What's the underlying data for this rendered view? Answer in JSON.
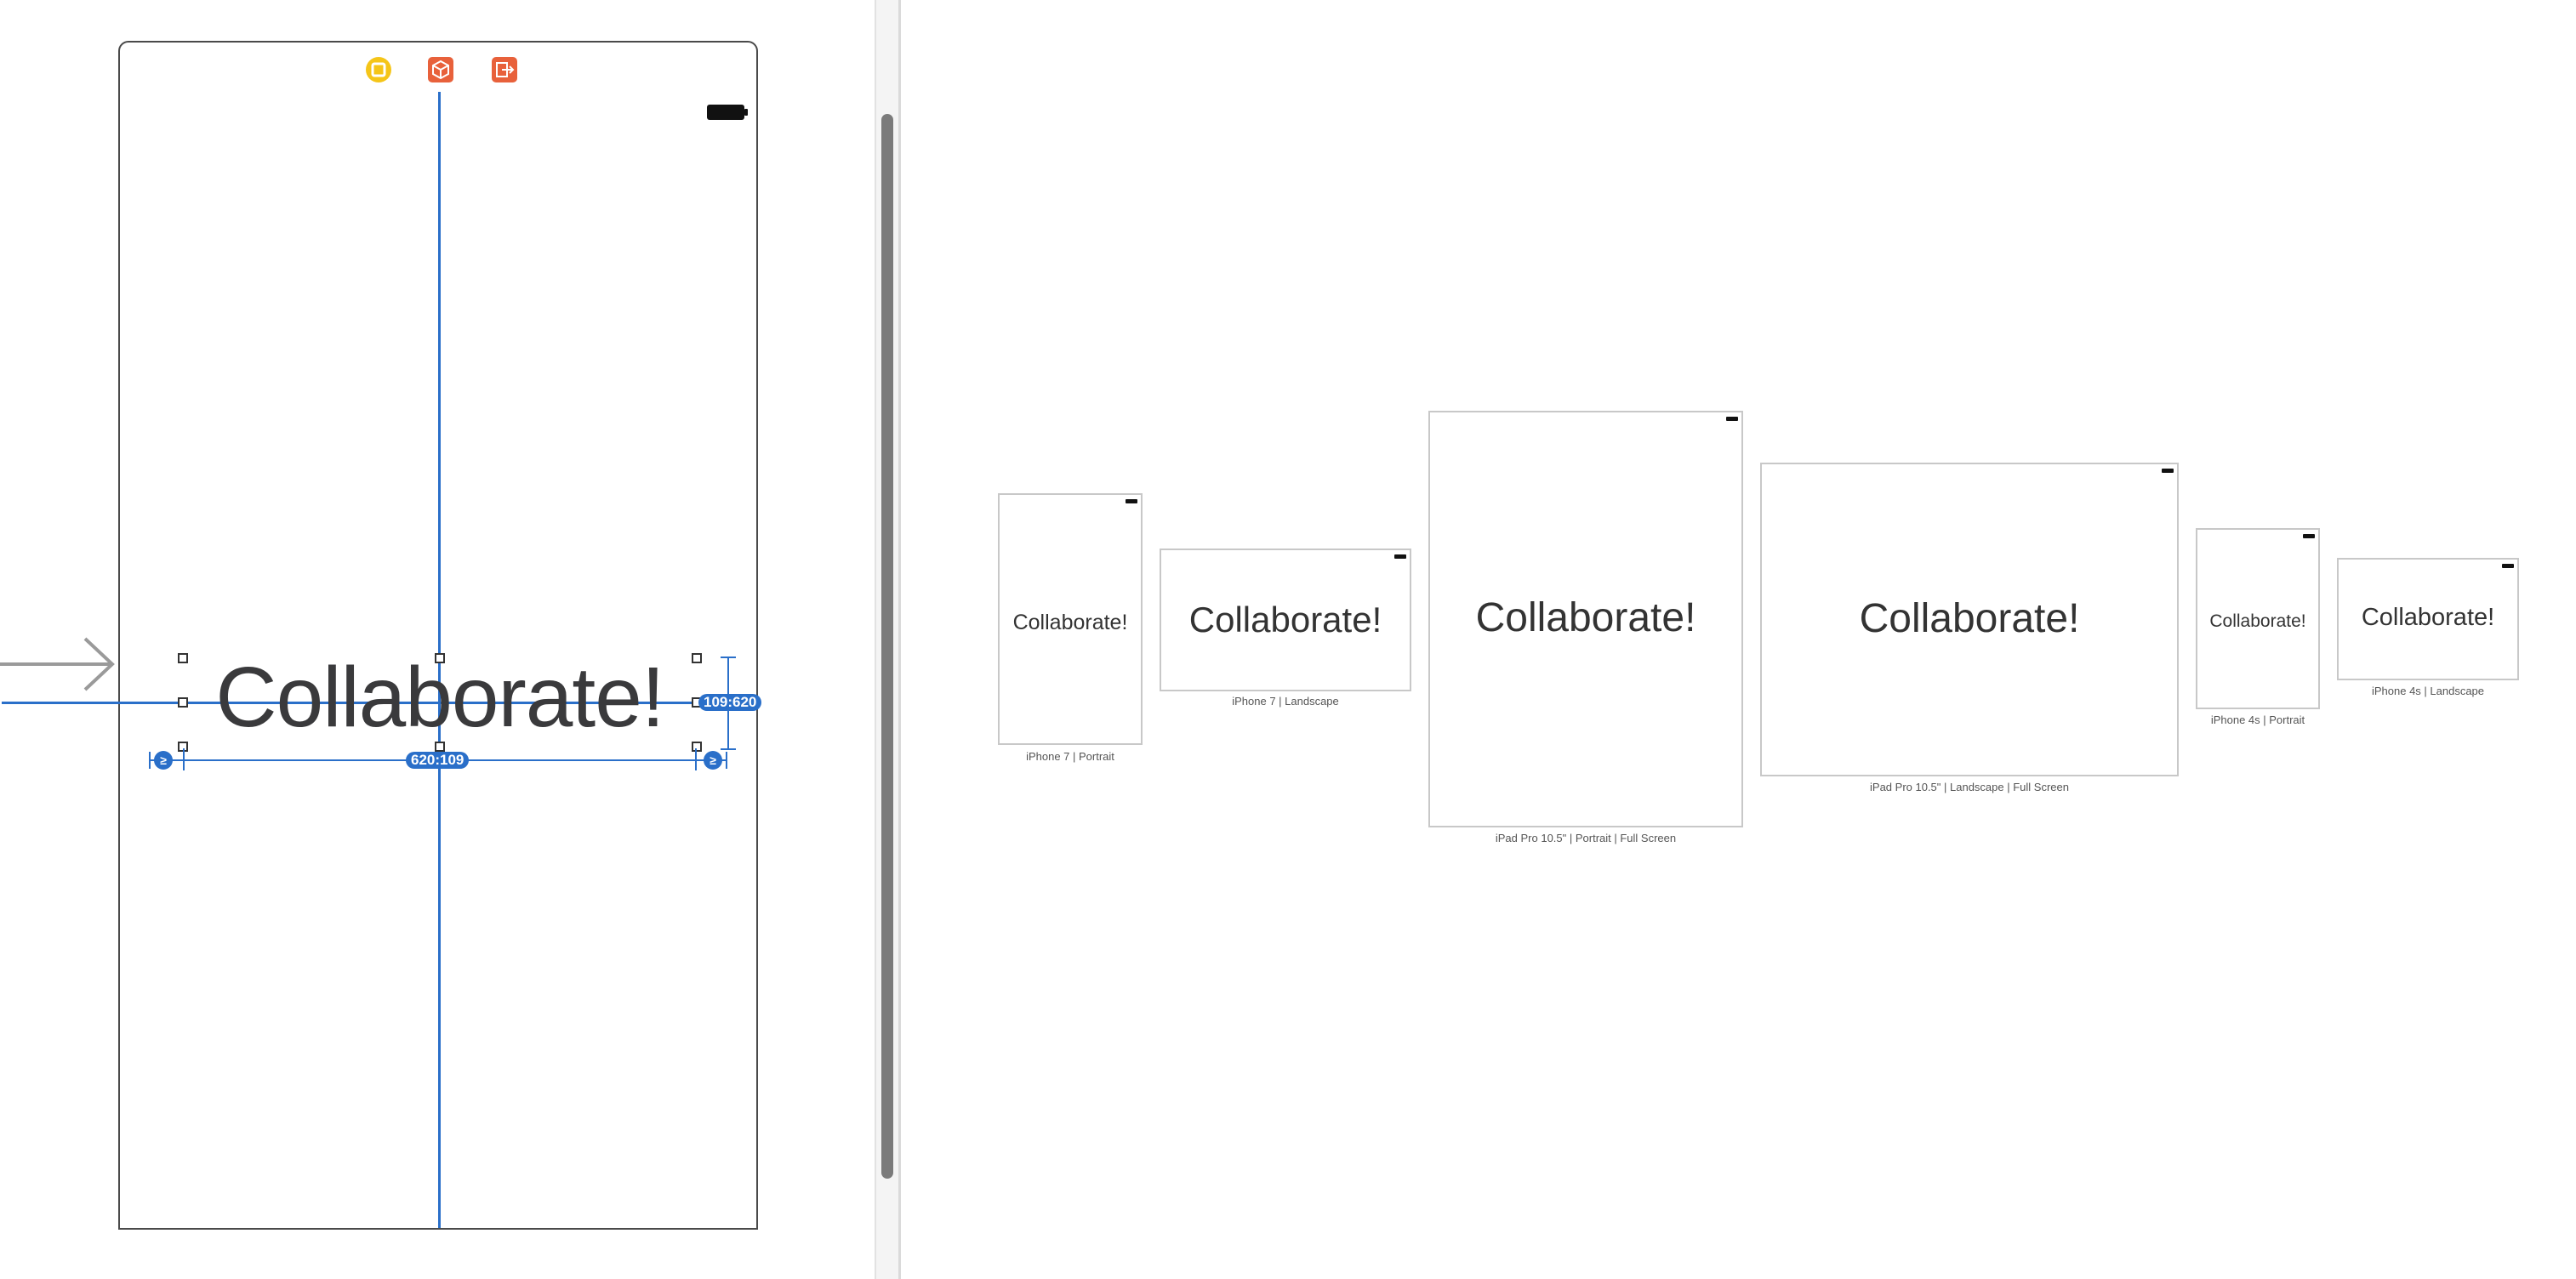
{
  "scene": {
    "label_text": "Collaborate!",
    "dock_icons": [
      "view-controller-icon",
      "first-responder-icon",
      "exit-icon"
    ],
    "height_constraint_badge": "109:620",
    "width_constraint_badge": "620:109",
    "ge_symbol": "≥"
  },
  "preview": {
    "devices": [
      {
        "name": "iphone7-portrait",
        "label_text": "Collaborate!",
        "caption": "iPhone 7 | Portrait"
      },
      {
        "name": "iphone7-landscape",
        "label_text": "Collaborate!",
        "caption": "iPhone 7 | Landscape"
      },
      {
        "name": "ipadpro-portrait",
        "label_text": "Collaborate!",
        "caption": "iPad Pro 10.5\" | Portrait | Full Screen"
      },
      {
        "name": "ipadpro-landscape",
        "label_text": "Collaborate!",
        "caption": "iPad Pro 10.5\" | Landscape | Full Screen"
      },
      {
        "name": "iphone4s-portrait",
        "label_text": "Collaborate!",
        "caption": "iPhone 4s | Portrait"
      },
      {
        "name": "iphone4s-landscape",
        "label_text": "Collaborate!",
        "caption": "iPhone 4s | Landscape"
      }
    ]
  },
  "colors": {
    "guide_blue": "#2a6fc9",
    "vc_icon_yellow": "#f5c518",
    "orange_icons": "#e8613b",
    "scene_border": "#4a4a4a",
    "label_text": "#3a3a3c"
  }
}
